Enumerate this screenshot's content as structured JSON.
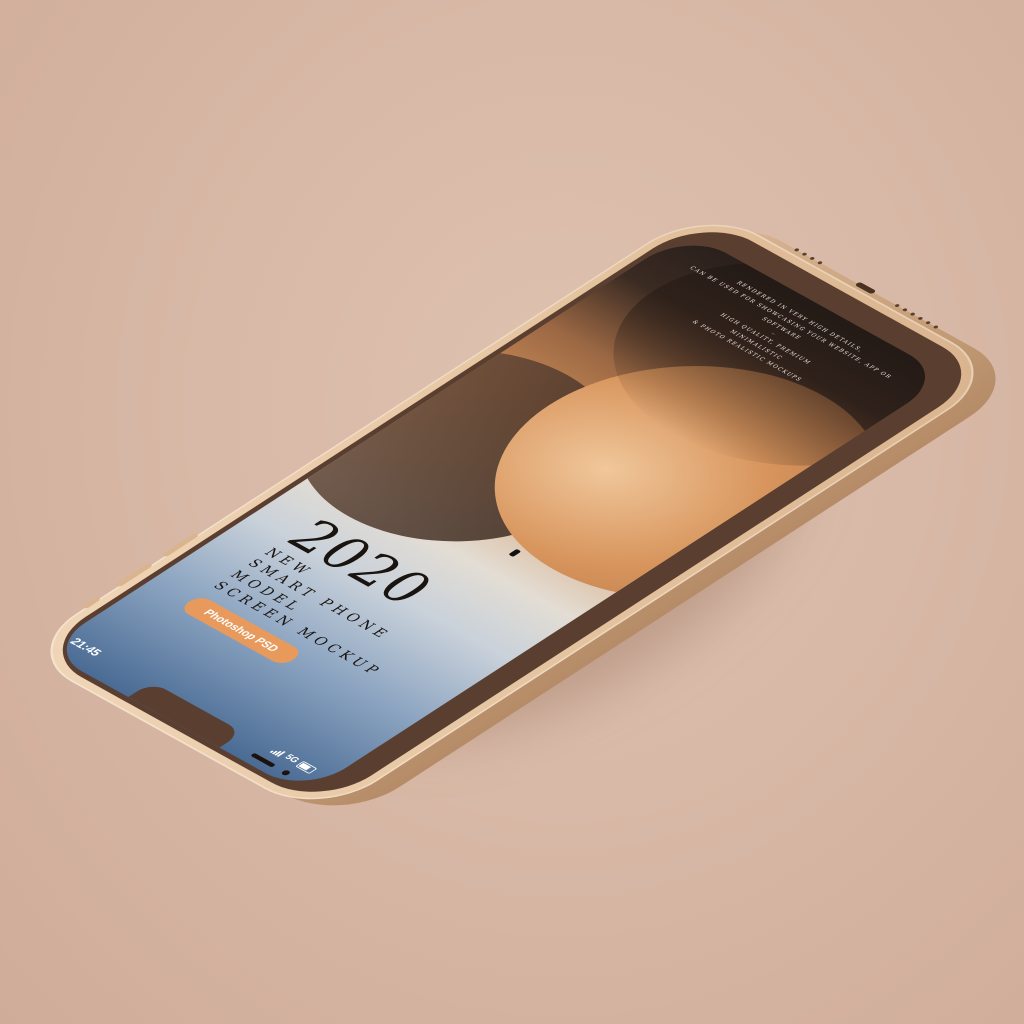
{
  "status_bar": {
    "time": "21:45",
    "network": "5G"
  },
  "headline": {
    "year": "2020",
    "lines": [
      "NEW",
      "SMART PHONE",
      "MODEL",
      "SCREEN MOCKUP"
    ],
    "button_label": "Photoshop PSD"
  },
  "fineprint": {
    "lines": [
      "RENDERED IN VERY HIGH DETAILS,",
      "CAN BE USED FOR SHOWCASING YOUR WEBSITE, APP OR SOFTWARE",
      "HIGH QUALITY, PREMIUM",
      "MINIMALISTIC",
      "& PHOTO REALISTIC MOCKUPS"
    ]
  },
  "colors": {
    "background": "#d8b8a6",
    "frame": "#e6c6a2",
    "bezel": "#5a3f30",
    "button": "#e89a5c",
    "headline_text": "#1a1410"
  },
  "icons": {
    "signal": "signal-bars-icon",
    "battery": "battery-icon"
  }
}
